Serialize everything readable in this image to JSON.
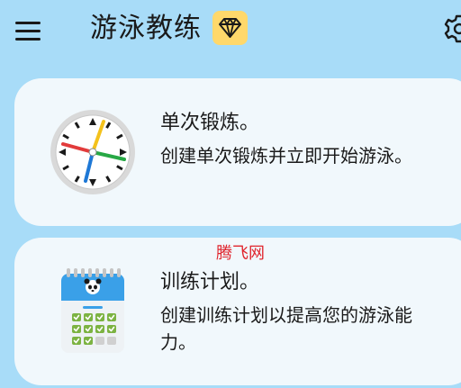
{
  "app": {
    "title": "游泳教练"
  },
  "header": {
    "menu_icon": "hamburger-menu-icon",
    "premium_icon": "diamond-icon",
    "settings_icon": "gear-icon",
    "premium_badge_color": "#ffd86b"
  },
  "cards": {
    "single": {
      "title": "单次锻炼。",
      "description": "创建单次锻炼并立即开始游泳。",
      "icon": "stopwatch-icon"
    },
    "plan": {
      "title": "训练计划。",
      "description": "创建训练计划以提高您的游泳能力。",
      "icon": "calendar-icon"
    }
  },
  "watermark": "腾飞网",
  "colors": {
    "background": "#a8dcf8",
    "card": "#f1f8fc",
    "accent_red": "#e23b3b",
    "accent_yellow": "#f4c21c",
    "accent_green": "#27a845",
    "accent_blue": "#1e78d6"
  }
}
